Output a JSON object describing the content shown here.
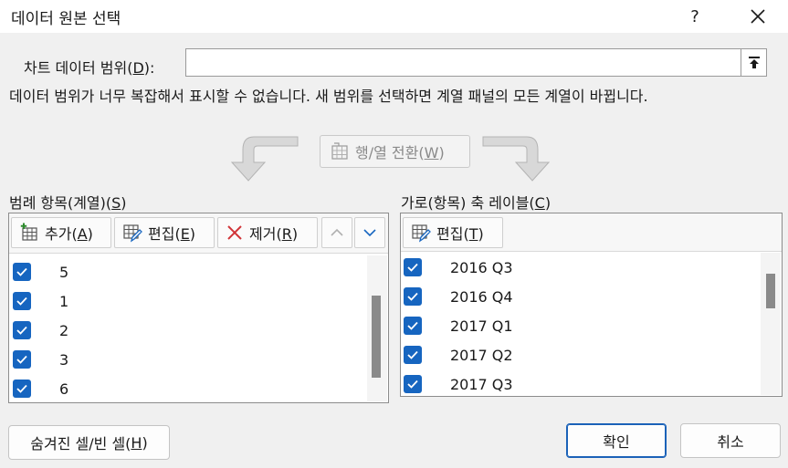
{
  "window": {
    "title": "데이터 원본 선택",
    "help": "?"
  },
  "range": {
    "label_prefix": "차트 데이터 범위(",
    "label_key": "D",
    "label_suffix": "):",
    "value": ""
  },
  "message": "데이터 범위가 너무 복잡해서 표시할 수 없습니다. 새 범위를 선택하면 계열 패널의 모든 계열이 바뀝니다.",
  "switch": {
    "label_prefix": "행/열 전환(",
    "label_key": "W",
    "label_suffix": ")"
  },
  "legend": {
    "title_prefix": "범례 항목(계열)(",
    "title_key": "S",
    "title_suffix": ")",
    "add": {
      "prefix": "추가(",
      "key": "A",
      "suffix": ")"
    },
    "edit": {
      "prefix": "편집(",
      "key": "E",
      "suffix": ")"
    },
    "remove": {
      "prefix": "제거(",
      "key": "R",
      "suffix": ")"
    },
    "items": [
      "5",
      "1",
      "2",
      "3",
      "6"
    ]
  },
  "axis": {
    "title_prefix": "가로(항목) 축 레이블(",
    "title_key": "C",
    "title_suffix": ")",
    "edit": {
      "prefix": "편집(",
      "key": "T",
      "suffix": ")"
    },
    "items": [
      "2016 Q3",
      "2016 Q4",
      "2017 Q1",
      "2017 Q2",
      "2017 Q3"
    ]
  },
  "bottom": {
    "hidden_prefix": "숨겨진 셀/빈 셀(",
    "hidden_key": "H",
    "hidden_suffix": ")",
    "ok": "확인",
    "cancel": "취소"
  },
  "colors": {
    "accent": "#1665c0",
    "ok_border": "#1b62b8"
  }
}
